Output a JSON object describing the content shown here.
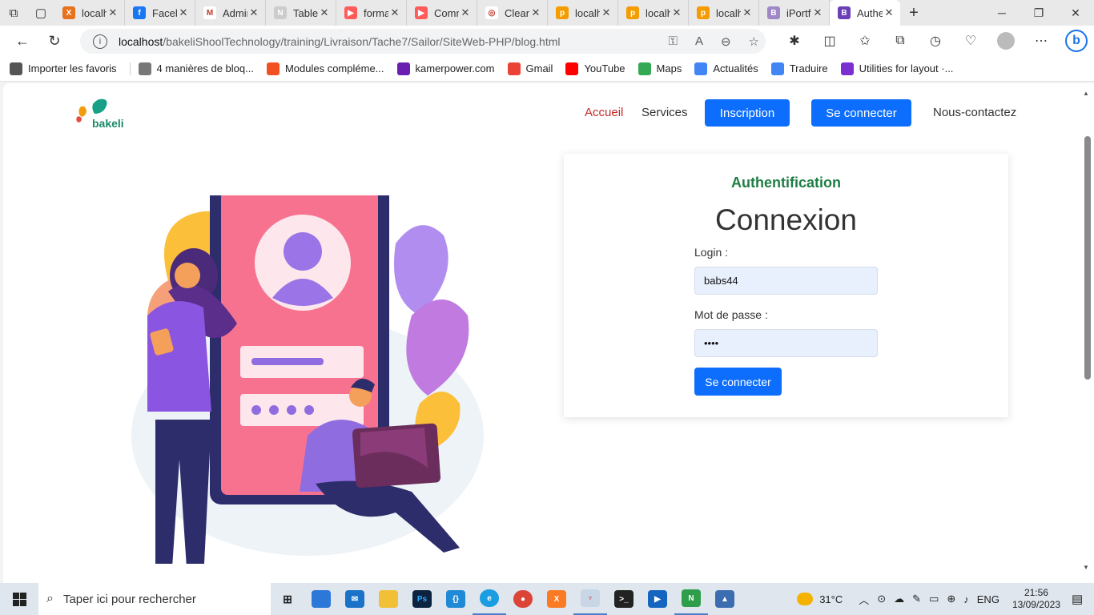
{
  "browser": {
    "tabs": [
      {
        "title": "localhost",
        "fav_color": "#e8711c",
        "glyph": "X"
      },
      {
        "title": "Facebook",
        "fav_color": "#1877f2",
        "glyph": "f"
      },
      {
        "title": "Admin",
        "fav_color": "#ffffff",
        "glyph": "M"
      },
      {
        "title": "Table",
        "fav_color": "#cccccc",
        "glyph": "N"
      },
      {
        "title": "formation",
        "fav_color": "#ff5b5b",
        "glyph": "▶"
      },
      {
        "title": "Comment",
        "fav_color": "#ff5b5b",
        "glyph": "▶"
      },
      {
        "title": "Clean",
        "fav_color": "#ffffff",
        "glyph": "◎"
      },
      {
        "title": "localhost",
        "fav_color": "#f59c00",
        "glyph": "p"
      },
      {
        "title": "localhost",
        "fav_color": "#f59c00",
        "glyph": "p"
      },
      {
        "title": "localhost",
        "fav_color": "#f59c00",
        "glyph": "p"
      },
      {
        "title": "iPortfolio",
        "fav_color": "#a088c8",
        "glyph": "B"
      },
      {
        "title": "Authentification",
        "fav_color": "#6a3fb8",
        "glyph": "B"
      }
    ],
    "url_host": "localhost",
    "url_path": "/bakeliShoolTechnology/training/Livraison/Tache7/Sailor/SiteWeb-PHP/blog.html",
    "favorites": [
      {
        "label": "Importer les favoris",
        "color": "#555555"
      },
      {
        "label": "4 manières de bloq...",
        "color": "#777777"
      },
      {
        "label": "Modules compléme...",
        "color": "#f25022"
      },
      {
        "label": "kamerpower.com",
        "color": "#6b1fb1"
      },
      {
        "label": "Gmail",
        "color": "#ea4335"
      },
      {
        "label": "YouTube",
        "color": "#ff0000"
      },
      {
        "label": "Maps",
        "color": "#34a853"
      },
      {
        "label": "Actualités",
        "color": "#4285f4"
      },
      {
        "label": "Traduire",
        "color": "#4285f4"
      },
      {
        "label": "Utilities for layout ·...",
        "color": "#7b2fd1"
      }
    ]
  },
  "site": {
    "logo_text": "bakeli",
    "nav": {
      "home": "Accueil",
      "services": "Services",
      "register": "Inscription",
      "login": "Se connecter",
      "contact": "Nous-contactez"
    },
    "form": {
      "heading": "Authentification",
      "title": "Connexion",
      "login_label": "Login :",
      "login_value": "babs44",
      "password_label": "Mot de passe :",
      "password_value": "••••",
      "submit": "Se connecter"
    }
  },
  "taskbar": {
    "search_placeholder": "Taper ici pour rechercher",
    "temperature": "31°C",
    "language": "ENG",
    "time": "21:56",
    "date": "13/09/2023"
  },
  "colors": {
    "primary": "#0d6efd",
    "active_link": "#c62828",
    "heading_green": "#1e7e44"
  }
}
